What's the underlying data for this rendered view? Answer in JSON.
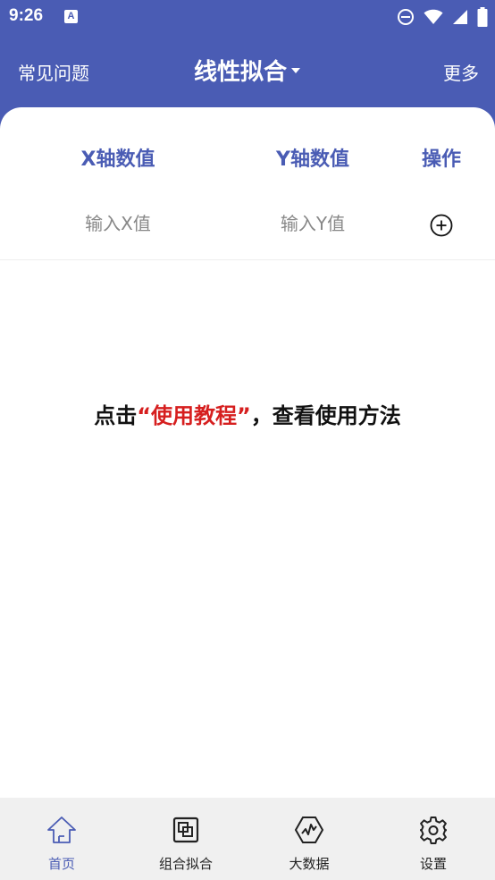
{
  "status_bar": {
    "time": "9:26",
    "notification_letter": "A"
  },
  "app_bar": {
    "left_link": "常见问题",
    "title": "线性拟合",
    "right_link": "更多"
  },
  "table": {
    "headers": [
      "X轴数值",
      "Y轴数值",
      "操作"
    ],
    "x_placeholder": "输入X值",
    "y_placeholder": "输入Y值",
    "x_value": "",
    "y_value": ""
  },
  "hint": {
    "prefix": "点击",
    "link": "“使用教程”",
    "suffix": "，查看使用方法"
  },
  "bottom_nav": {
    "items": [
      {
        "label": "首页",
        "icon": "home-icon",
        "active": true
      },
      {
        "label": "组合拟合",
        "icon": "combine-icon",
        "active": false
      },
      {
        "label": "大数据",
        "icon": "chart-hexagon-icon",
        "active": false
      },
      {
        "label": "设置",
        "icon": "gear-icon",
        "active": false
      }
    ]
  },
  "colors": {
    "primary": "#4a5cb4",
    "accent_red": "#d61f1f",
    "nav_background": "#f0f0f0",
    "text_dark": "#111111"
  }
}
